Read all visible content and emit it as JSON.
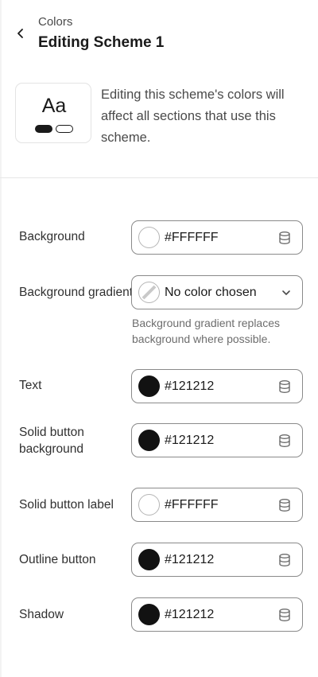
{
  "header": {
    "breadcrumb": "Colors",
    "title": "Editing Scheme 1"
  },
  "preview": {
    "sample_text": "Aa",
    "description": "Editing this scheme's colors will affect all sections that use this scheme."
  },
  "colors": {
    "text_color": "#121212",
    "background_color": "#FFFFFF",
    "border_color": "#8a8a8a"
  },
  "fields": [
    {
      "label": "Background",
      "value": "#FFFFFF",
      "swatch": "#FFFFFF"
    },
    {
      "label": "Background gradient",
      "value": "No color chosen",
      "help": "Background gradient replaces background where possible."
    },
    {
      "label": "Text",
      "value": "#121212",
      "swatch": "#121212"
    },
    {
      "label": "Solid button background",
      "value": "#121212",
      "swatch": "#121212"
    },
    {
      "label": "Solid button label",
      "value": "#FFFFFF",
      "swatch": "#FFFFFF"
    },
    {
      "label": "Outline button",
      "value": "#121212",
      "swatch": "#121212"
    },
    {
      "label": "Shadow",
      "value": "#121212",
      "swatch": "#121212"
    }
  ],
  "icons": {
    "back": "chevron-left-icon",
    "database": "database-icon",
    "dropdown": "chevron-down-icon",
    "empty_swatch": "no-color-icon"
  }
}
